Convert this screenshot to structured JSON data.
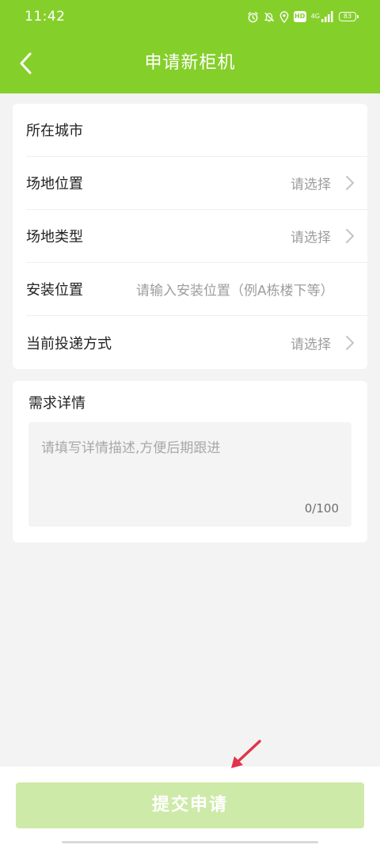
{
  "status_bar": {
    "time": "11:42",
    "network": "4G",
    "battery": "83"
  },
  "header": {
    "title": "申请新柜机"
  },
  "form": {
    "rows": [
      {
        "label": "所在城市",
        "value": ""
      },
      {
        "label": "场地位置",
        "value": "请选择"
      },
      {
        "label": "场地类型",
        "value": "请选择"
      },
      {
        "label": "安装位置",
        "placeholder": "请输入安装位置（例A栋楼下等）"
      },
      {
        "label": "当前投递方式",
        "value": "请选择"
      }
    ]
  },
  "detail": {
    "title": "需求详情",
    "placeholder": "请填写详情描述,方便后期跟进",
    "counter": "0/100"
  },
  "submit": {
    "label": "提交申请"
  },
  "colors": {
    "header": "#85cf2b",
    "submit_disabled": "#cdeaa8",
    "annotation": "#e0344a"
  }
}
